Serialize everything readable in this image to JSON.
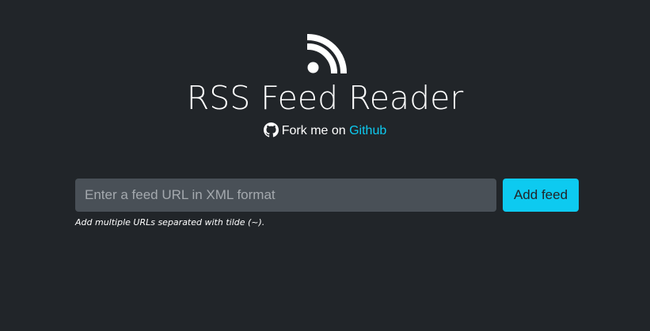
{
  "header": {
    "logo_icon": "rss-icon",
    "title": "RSS Feed Reader",
    "fork_icon": "github-icon",
    "fork_text": "Fork me on ",
    "fork_link": "Github"
  },
  "form": {
    "input_value": "",
    "input_placeholder": "Enter a feed URL in XML format",
    "add_button_label": "Add feed",
    "hint": "Add multiple URLs separated with tilde (~)."
  },
  "colors": {
    "background": "#212529",
    "accent": "#0dcaf0",
    "input_bg": "#495057",
    "text": "#ffffff"
  }
}
